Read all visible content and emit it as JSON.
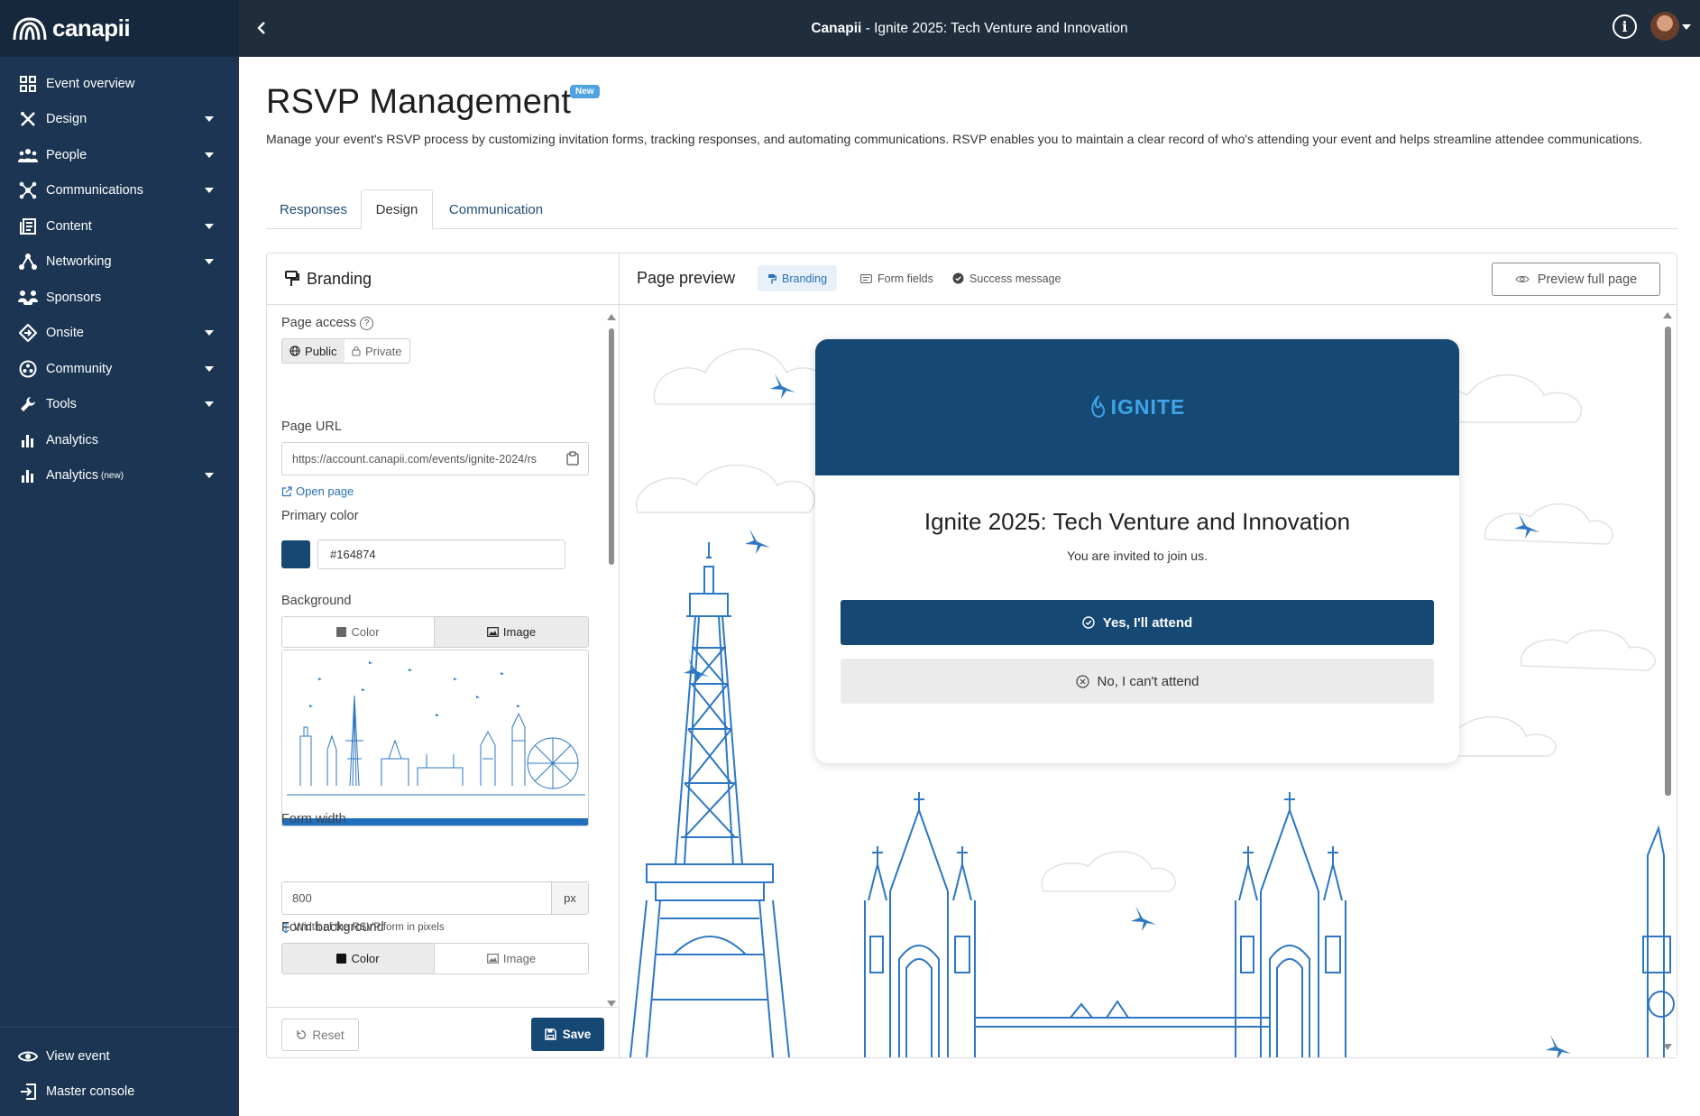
{
  "app": {
    "logo_text": "canapii"
  },
  "sidebar": {
    "items": [
      {
        "label": "Event overview",
        "icon": "grid-icon",
        "caret": false
      },
      {
        "label": "Design",
        "icon": "design-tools-icon",
        "caret": true
      },
      {
        "label": "People",
        "icon": "people-icon",
        "caret": true
      },
      {
        "label": "Communications",
        "icon": "network-nodes-icon",
        "caret": true
      },
      {
        "label": "Content",
        "icon": "content-icon",
        "caret": true
      },
      {
        "label": "Networking",
        "icon": "networking-icon",
        "caret": true
      },
      {
        "label": "Sponsors",
        "icon": "sponsors-icon",
        "caret": false
      },
      {
        "label": "Onsite",
        "icon": "onsite-diamond-icon",
        "caret": true
      },
      {
        "label": "Community",
        "icon": "community-icon",
        "caret": true
      },
      {
        "label": "Tools",
        "icon": "wrench-icon",
        "caret": true
      },
      {
        "label": "Analytics",
        "icon": "bar-chart-icon",
        "caret": false
      },
      {
        "label": "Analytics",
        "sup": "(new)",
        "icon": "bar-chart-icon",
        "caret": true
      }
    ],
    "bottom": [
      {
        "label": "View event",
        "icon": "eye-icon"
      },
      {
        "label": "Master console",
        "icon": "exit-icon"
      }
    ]
  },
  "topbar": {
    "brand": "Canapii",
    "separator": " - ",
    "event_title": "Ignite 2025: Tech Venture and Innovation",
    "info_icon": "info-icon"
  },
  "page": {
    "title": "RSVP Management",
    "badge": "New",
    "description": "Manage your event's RSVP process by customizing invitation forms, tracking responses, and automating communications. RSVP enables you to maintain a clear record of who's attending your event and helps streamline attendee communications."
  },
  "tabs": [
    {
      "label": "Responses",
      "active": false
    },
    {
      "label": "Design",
      "active": true
    },
    {
      "label": "Communication",
      "active": false
    }
  ],
  "branding_panel": {
    "title": "Branding",
    "page_access": {
      "label": "Page access",
      "help": "?",
      "options": [
        "Public",
        "Private"
      ],
      "selected": "Public"
    },
    "page_url": {
      "label": "Page URL",
      "value": "https://account.canapii.com/events/ignite-2024/rs"
    },
    "open_page": "Open page",
    "primary_color": {
      "label": "Primary color",
      "value": "#164874"
    },
    "background": {
      "label": "Background",
      "options": [
        "Color",
        "Image"
      ],
      "selected": "Image"
    },
    "form_width": {
      "label": "Form width",
      "value": "800",
      "unit": "px",
      "hint": "Width of the RSVP form in pixels"
    },
    "form_background": {
      "label": "Form background",
      "options": [
        "Color",
        "Image"
      ],
      "selected": "Color"
    },
    "reset_label": "Reset",
    "save_label": "Save"
  },
  "preview_panel": {
    "title": "Page preview",
    "pills": [
      {
        "label": "Branding",
        "icon": "paint-roller-icon",
        "selected": true
      },
      {
        "label": "Form fields",
        "icon": "form-icon",
        "selected": false
      },
      {
        "label": "Success message",
        "icon": "check-circle-icon",
        "selected": false
      }
    ],
    "preview_full_label": "Preview full page",
    "form": {
      "logo_text": "IGNITE",
      "title": "Ignite 2025: Tech Venture and Innovation",
      "subtitle": "You are invited to join us.",
      "yes_label": "Yes, I'll attend",
      "no_label": "No, I can't attend"
    }
  },
  "colors": {
    "sidebar_bg": "#1b3553",
    "topbar_bg": "#1f2d3d",
    "primary": "#164874",
    "link": "#2a72b5",
    "illustration": "#2d77c4"
  }
}
